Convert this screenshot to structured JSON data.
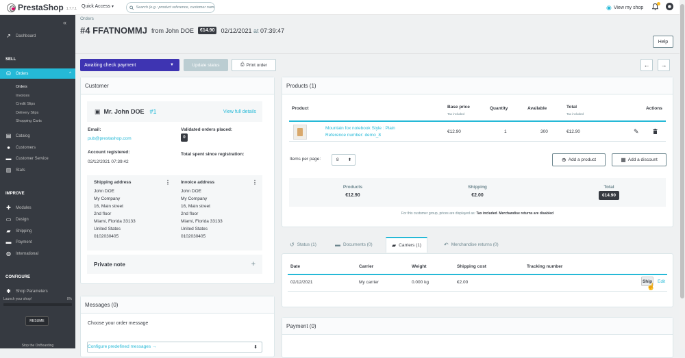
{
  "header": {
    "brand": "PrestaShop",
    "version": "1.7.7.1",
    "quick_access": "Quick Access",
    "search_placeholder": "Search (e.g.: product reference, customer name...)",
    "view_shop": "View my shop",
    "notifications_count": 1
  },
  "sidebar": {
    "dashboard": "Dashboard",
    "sections": {
      "sell": "SELL",
      "improve": "IMPROVE",
      "configure": "CONFIGURE"
    },
    "orders": "Orders",
    "orders_sub": [
      "Orders",
      "Invoices",
      "Credit Slips",
      "Delivery Slips",
      "Shopping Carts"
    ],
    "sell_items": [
      "Catalog",
      "Customers",
      "Customer Service",
      "Stats"
    ],
    "improve_items": [
      "Modules",
      "Design",
      "Shipping",
      "Payment",
      "International"
    ],
    "configure_items": [
      "Shop Parameters"
    ],
    "onboarding": {
      "label": "Launch your shop!",
      "percent": "0%",
      "resume": "RESUME",
      "stop": "Stop the OnBoarding"
    }
  },
  "page": {
    "breadcrumb": "Orders",
    "order_ref": "#4 FFATNOMMJ",
    "from": "from John DOE",
    "total_badge": "€14.90",
    "date": "02/12/2021",
    "at": "at",
    "time": "07:39:47",
    "help": "Help"
  },
  "toolbar": {
    "status": "Awaiting check payment",
    "update_status": "Update status",
    "print_order": "Print order"
  },
  "customer": {
    "title": "Customer",
    "name": "Mr. John DOE",
    "id": "#1",
    "view_full": "View full details",
    "email_label": "Email:",
    "email": "pub@prestashop.com",
    "registered_label": "Account registered:",
    "registered": "02/12/2021 07:39:42",
    "validated_label": "Validated orders placed:",
    "validated": "0",
    "spent_label": "Total spent since registration:",
    "shipping_title": "Shipping address",
    "invoice_title": "Invoice address",
    "shipping_address": [
      "John DOE",
      "My Company",
      "16, Main street",
      "2nd floor",
      "Miami, Florida 33133",
      "United States",
      "0102030405"
    ],
    "invoice_address": [
      "John DOE",
      "My Company",
      "16, Main street",
      "2nd floor",
      "Miami, Florida 33133",
      "United States",
      "0102030405"
    ],
    "private_note": "Private note"
  },
  "messages": {
    "title": "Messages (0)",
    "choose_label": "Choose your order message",
    "configure_link": "Configure predefined messages →"
  },
  "products": {
    "title": "Products (1)",
    "headers": {
      "product": "Product",
      "base_price": "Base price",
      "tax_included": "Tax included",
      "quantity": "Quantity",
      "available": "Available",
      "total": "Total",
      "actions": "Actions"
    },
    "row": {
      "name": "Mountain fox notebook Style : Plain",
      "reference": "Reference number: demo_8",
      "base_price": "€12.90",
      "quantity": "1",
      "available": "300",
      "total": "€12.90"
    },
    "items_per_page_label": "Items per page:",
    "items_per_page": "8",
    "add_product": "Add a product",
    "add_discount": "Add a discount",
    "totals": {
      "products_label": "Products",
      "products": "€12.90",
      "shipping_label": "Shipping",
      "shipping": "€2.00",
      "total_label": "Total",
      "total": "€14.90"
    },
    "tax_note_prefix": "For this customer group, prices are displayed as:",
    "tax_note_bold": "Tax included",
    "tax_note_suffix": "Merchandise returns are disabled"
  },
  "tabs": [
    "Status (1)",
    "Documents (0)",
    "Carriers (1)",
    "Merchandise returns (0)"
  ],
  "carriers": {
    "headers": {
      "date": "Date",
      "carrier": "Carrier",
      "weight": "Weight",
      "shipping_cost": "Shipping cost",
      "tracking": "Tracking number"
    },
    "row": {
      "date": "02/12/2021",
      "carrier": "My carrier",
      "weight": "0.000 kg",
      "cost": "€2.00",
      "ship": "Ship",
      "edit": "Edit"
    }
  },
  "payment": {
    "title": "Payment (0)"
  }
}
